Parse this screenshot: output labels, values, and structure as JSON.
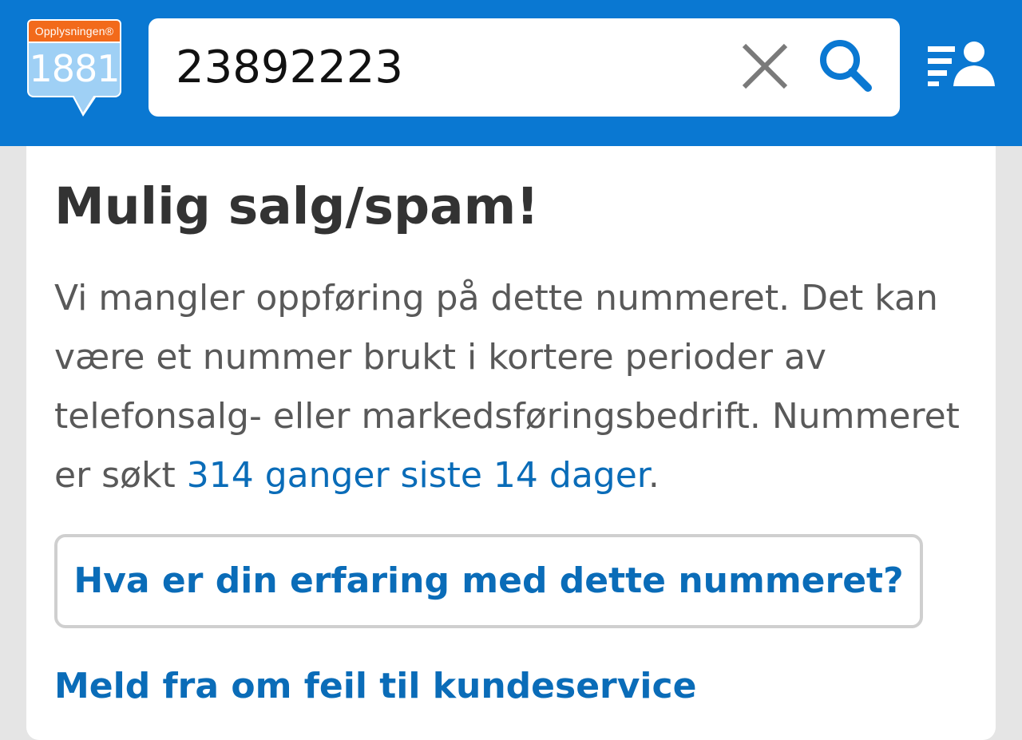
{
  "header": {
    "brand_name": "Opplysningen®",
    "brand_number": "1881",
    "search": {
      "value": "23892223",
      "clear_icon": "close-icon",
      "search_icon": "search-icon"
    },
    "menu_icon": "contacts-menu-icon"
  },
  "result": {
    "title": "Mulig salg/spam!",
    "description_text": "Vi mangler oppføring på dette nummeret. Det kan være et nummer brukt i kortere perioder av telefonsalg- eller markedsføringsbedrift. Nummeret er søkt ",
    "search_count_link": "314 ganger siste 14 dager",
    "description_end": ".",
    "experience_button": "Hva er din erfaring med dette nummeret?",
    "report_link": "Meld fra om feil til kundeservice"
  },
  "colors": {
    "header_blue": "#0a78d2",
    "link_blue": "#0a6cb8",
    "brand_orange": "#f26a1b",
    "brand_light_blue": "#9fd0f5",
    "title_text": "#333333",
    "body_text": "#595959"
  }
}
